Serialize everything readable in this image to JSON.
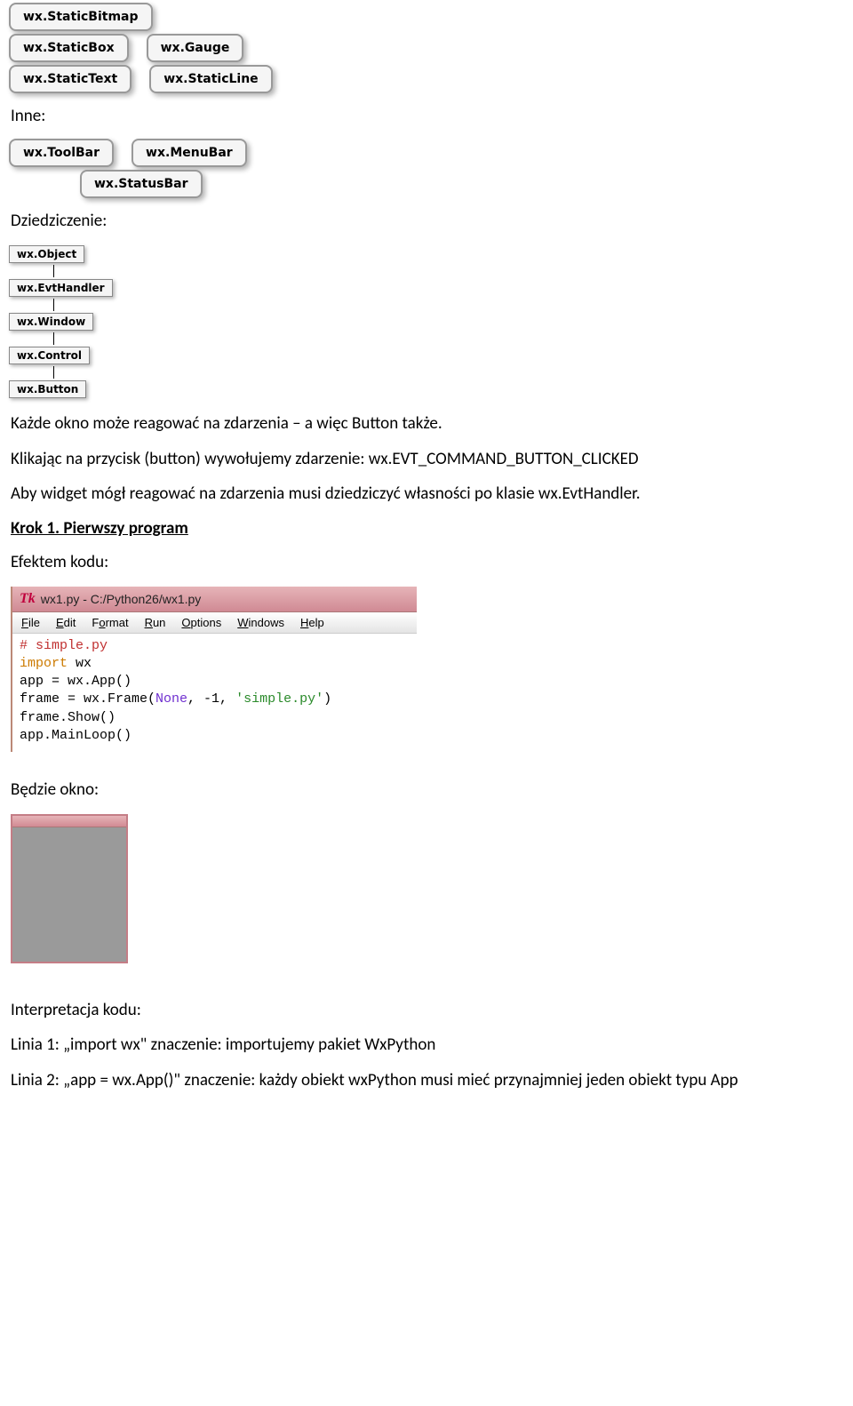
{
  "chipGroups": {
    "static": [
      [
        "wx.StaticBitmap"
      ],
      [
        "wx.StaticBox",
        "wx.Gauge"
      ],
      [
        "wx.StaticText",
        "wx.StaticLine"
      ]
    ],
    "inne": [
      [
        "wx.ToolBar",
        "wx.MenuBar"
      ],
      [
        "wx.StatusBar"
      ]
    ],
    "inherit": [
      "wx.Object",
      "wx.EvtHandler",
      "wx.Window",
      "wx.Control",
      "wx.Button"
    ]
  },
  "labels": {
    "inne": "Inne:",
    "dziedziczenie": "Dziedziczenie:",
    "efektem": "Efektem kodu:",
    "bedzie": "Będzie okno:",
    "interpretacja": "Interpretacja kodu:"
  },
  "paragraphs": {
    "p1": "Każde okno może reagować na zdarzenia – a więc Button także.",
    "p2": "Klikając na przycisk (button) wywołujemy zdarzenie: wx.EVT_COMMAND_BUTTON_CLICKED",
    "p3": "Aby widget   mógł reagować na zdarzenia musi dziedziczyć własności po klasie wx.EvtHandler.",
    "step": "Krok 1. Pierwszy program",
    "linia1": "Linia 1: „import wx\" znaczenie: importujemy pakiet WxPython",
    "linia2": "Linia 2: „app = wx.App()\" znaczenie: każdy obiekt wxPython musi mieć przynajmniej jeden obiekt typu App"
  },
  "editor": {
    "title": "wx1.py - C:/Python26/wx1.py",
    "menu": [
      "File",
      "Edit",
      "Format",
      "Run",
      "Options",
      "Windows",
      "Help"
    ],
    "code": {
      "l1_comment": "# simple.py",
      "l2_kw": "import",
      "l2_rest": " wx",
      "l3": "app = wx.App()",
      "l4a": "frame = wx.Frame(",
      "l4_none": "None",
      "l4b": ", -1, ",
      "l4_str": "'simple.py'",
      "l4c": ")",
      "l5": "frame.Show()",
      "l6": "app.MainLoop()"
    }
  }
}
